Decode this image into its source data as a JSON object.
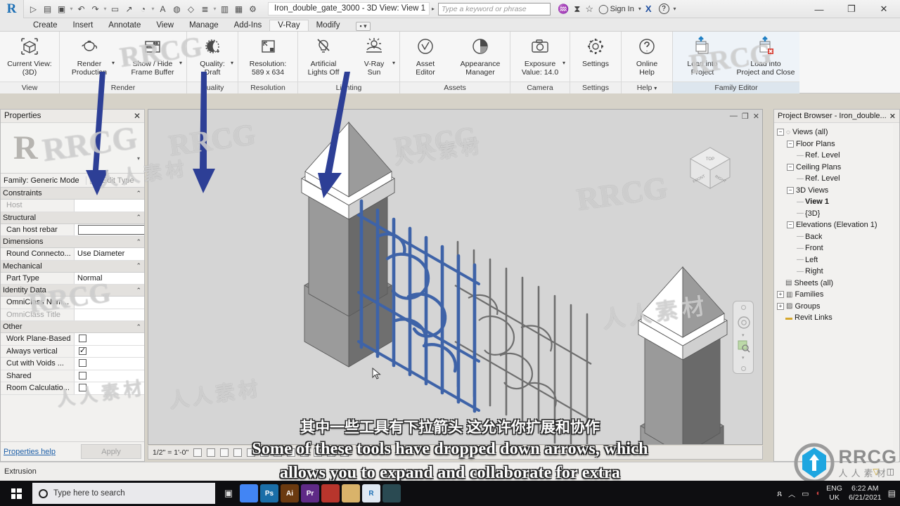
{
  "titlebar": {
    "app_logo": "revit-r-logo",
    "document_title": "Iron_double_gate_3000 - 3D View: View 1",
    "search_placeholder": "Type a keyword or phrase",
    "signin_label": "Sign In",
    "quick_access": [
      {
        "name": "open-icon",
        "glyph": "▷"
      },
      {
        "name": "save-icon",
        "glyph": "▤"
      },
      {
        "name": "save-as-icon",
        "glyph": "▣"
      },
      {
        "name": "undo-icon",
        "glyph": "↶"
      },
      {
        "name": "redo-icon",
        "glyph": "↷"
      },
      {
        "name": "measure-icon",
        "glyph": "▭"
      },
      {
        "name": "aligned-dimension-icon",
        "glyph": "↗"
      },
      {
        "name": "tag-icon",
        "glyph": "◔"
      },
      {
        "name": "text-icon",
        "glyph": "A"
      },
      {
        "name": "default-3d-view-icon",
        "glyph": "◍"
      },
      {
        "name": "section-icon",
        "glyph": "◇"
      },
      {
        "name": "thin-lines-icon",
        "glyph": "≣"
      },
      {
        "name": "close-hidden-icon",
        "glyph": "▥"
      },
      {
        "name": "switch-windows-icon",
        "glyph": "▦"
      },
      {
        "name": "customize-qat-icon",
        "glyph": "⚙"
      }
    ],
    "title_icons": [
      {
        "name": "search-binoculars-icon",
        "glyph": "♒"
      },
      {
        "name": "autodesk-community-icon",
        "glyph": "⧗"
      },
      {
        "name": "favorites-star-icon",
        "glyph": "☆"
      },
      {
        "name": "user-account-icon",
        "glyph": "◯"
      }
    ],
    "exchange_label": "X",
    "help_label": "?",
    "window_buttons": {
      "minimize": "—",
      "maximize": "❐",
      "close": "✕"
    }
  },
  "tabs": [
    {
      "label": "Create",
      "active": false
    },
    {
      "label": "Insert",
      "active": false
    },
    {
      "label": "Annotate",
      "active": false
    },
    {
      "label": "View",
      "active": false
    },
    {
      "label": "Manage",
      "active": false
    },
    {
      "label": "Add-Ins",
      "active": false
    },
    {
      "label": "V-Ray",
      "active": true
    },
    {
      "label": "Modify",
      "active": false
    }
  ],
  "tab_extra": "▪ ▾",
  "ribbon": {
    "groups": [
      {
        "name": "View",
        "buttons": [
          {
            "label": "Current View:\n(3D)",
            "icon": "current-view-cube-icon",
            "dropdown": false,
            "width": "wide"
          }
        ]
      },
      {
        "name": "Render",
        "buttons": [
          {
            "label": "Render\nProduction",
            "icon": "teapot-render-icon",
            "dropdown": true,
            "width": "wide"
          },
          {
            "label": "Show / Hide\nFrame Buffer",
            "icon": "frame-buffer-icon",
            "dropdown": true,
            "width": "xwide"
          }
        ]
      },
      {
        "name": "Quality",
        "buttons": [
          {
            "label": "Quality:\nDraft",
            "icon": "quality-moon-icon",
            "dropdown": true,
            "width": ""
          }
        ]
      },
      {
        "name": "Resolution",
        "buttons": [
          {
            "label": "Resolution:\n589 x 634",
            "icon": "resolution-frame-icon",
            "dropdown": false,
            "width": "wide"
          }
        ]
      },
      {
        "name": "Lighting",
        "buttons": [
          {
            "label": "Artificial\nLights Off",
            "icon": "light-bulb-off-icon",
            "dropdown": false,
            "width": ""
          },
          {
            "label": "V-Ray\nSun",
            "icon": "sun-icon",
            "dropdown": true,
            "width": ""
          }
        ]
      },
      {
        "name": "Assets",
        "buttons": [
          {
            "label": "Asset\nEditor",
            "icon": "asset-editor-icon",
            "dropdown": false,
            "width": ""
          },
          {
            "label": "Appearance\nManager",
            "icon": "appearance-manager-icon",
            "dropdown": false,
            "width": "wide"
          }
        ]
      },
      {
        "name": "Camera",
        "buttons": [
          {
            "label": "Exposure\nValue: 14.0",
            "icon": "camera-icon",
            "dropdown": true,
            "width": "wide"
          }
        ]
      },
      {
        "name": "Settings",
        "buttons": [
          {
            "label": "Settings",
            "icon": "gear-icon",
            "dropdown": false,
            "width": ""
          }
        ]
      },
      {
        "name": "Help",
        "name_dropdown": true,
        "buttons": [
          {
            "label": "Online\nHelp",
            "icon": "question-circle-icon",
            "dropdown": false,
            "width": ""
          }
        ]
      },
      {
        "name": "Family Editor",
        "highlight": true,
        "buttons": [
          {
            "label": "Load into\nProject",
            "icon": "load-into-project-icon",
            "dropdown": false,
            "width": "wide"
          },
          {
            "label": "Load into\nProject and Close",
            "icon": "load-into-project-close-icon",
            "dropdown": false,
            "width": "xwide"
          }
        ]
      }
    ]
  },
  "properties": {
    "title": "Properties",
    "close_glyph": "✕",
    "family_label": "Family: Generic Mode",
    "edit_type_label": "Edit Type",
    "rows": [
      {
        "kind": "section",
        "label": "Constraints"
      },
      {
        "kind": "row",
        "key": "Host",
        "value": "",
        "key_dim": true,
        "value_type": "text"
      },
      {
        "kind": "section",
        "label": "Structural"
      },
      {
        "kind": "row",
        "key": "Can host rebar",
        "value": "",
        "value_type": "checkbox-big",
        "checked": false
      },
      {
        "kind": "section",
        "label": "Dimensions"
      },
      {
        "kind": "row",
        "key": "Round Connecto...",
        "value": "Use Diameter",
        "value_type": "text"
      },
      {
        "kind": "section",
        "label": "Mechanical"
      },
      {
        "kind": "row",
        "key": "Part Type",
        "value": "Normal",
        "value_type": "text"
      },
      {
        "kind": "section",
        "label": "Identity Data"
      },
      {
        "kind": "row",
        "key": "OmniClass Num...",
        "value": "",
        "value_type": "text"
      },
      {
        "kind": "row",
        "key": "OmniClass Title",
        "value": "",
        "key_dim": true,
        "value_type": "text"
      },
      {
        "kind": "section",
        "label": "Other"
      },
      {
        "kind": "row",
        "key": "Work Plane-Based",
        "value": "",
        "value_type": "checkbox",
        "checked": false
      },
      {
        "kind": "row",
        "key": "Always vertical",
        "value": "",
        "value_type": "checkbox",
        "checked": true
      },
      {
        "kind": "row",
        "key": "Cut with Voids ...",
        "value": "",
        "value_type": "checkbox",
        "checked": false
      },
      {
        "kind": "row",
        "key": "Shared",
        "value": "",
        "value_type": "checkbox",
        "checked": false
      },
      {
        "kind": "row",
        "key": "Room Calculatio...",
        "value": "",
        "value_type": "checkbox",
        "checked": false
      }
    ],
    "help_link": "Properties help",
    "apply_label": "Apply"
  },
  "project_browser": {
    "title": "Project Browser - Iron_double...",
    "close_glyph": "✕",
    "tree": [
      {
        "label": "Views (all)",
        "depth": 0,
        "expander": "−",
        "icon": "views-icon",
        "bold": false
      },
      {
        "label": "Floor Plans",
        "depth": 1,
        "expander": "−",
        "icon": "",
        "bold": false
      },
      {
        "label": "Ref. Level",
        "depth": 2,
        "expander": "",
        "icon": "",
        "bold": false
      },
      {
        "label": "Ceiling Plans",
        "depth": 1,
        "expander": "−",
        "icon": "",
        "bold": false
      },
      {
        "label": "Ref. Level",
        "depth": 2,
        "expander": "",
        "icon": "",
        "bold": false
      },
      {
        "label": "3D Views",
        "depth": 1,
        "expander": "−",
        "icon": "",
        "bold": false
      },
      {
        "label": "View 1",
        "depth": 2,
        "expander": "",
        "icon": "",
        "bold": true
      },
      {
        "label": "{3D}",
        "depth": 2,
        "expander": "",
        "icon": "",
        "bold": false
      },
      {
        "label": "Elevations (Elevation 1)",
        "depth": 1,
        "expander": "−",
        "icon": "",
        "bold": false
      },
      {
        "label": "Back",
        "depth": 2,
        "expander": "",
        "icon": "",
        "bold": false
      },
      {
        "label": "Front",
        "depth": 2,
        "expander": "",
        "icon": "",
        "bold": false
      },
      {
        "label": "Left",
        "depth": 2,
        "expander": "",
        "icon": "",
        "bold": false
      },
      {
        "label": "Right",
        "depth": 2,
        "expander": "",
        "icon": "",
        "bold": false
      },
      {
        "label": "Sheets (all)",
        "depth": 0,
        "expander": "",
        "icon": "sheets-icon",
        "bold": false
      },
      {
        "label": "Families",
        "depth": 0,
        "expander": "+",
        "icon": "families-icon",
        "bold": false
      },
      {
        "label": "Groups",
        "depth": 0,
        "expander": "+",
        "icon": "groups-icon",
        "bold": false
      },
      {
        "label": "Revit Links",
        "depth": 0,
        "expander": "",
        "icon": "revit-links-icon",
        "bold": false
      }
    ]
  },
  "viewport": {
    "minimize_glyph": "—",
    "restore_glyph": "❐",
    "close_glyph": "✕",
    "navcube_faces": {
      "top": "TOP",
      "front": "FRONT",
      "right": "RIGHT"
    },
    "model_colors": {
      "gate_selected": "#3e63a8",
      "gate_unselected": "#7c7c7c",
      "pillar_dark": "#6e6e6e",
      "pillar_light": "#b5b5b5",
      "background": "#d5d5d5"
    }
  },
  "view_control_bar": {
    "scale": "1/2\" = 1'-0\"",
    "detail_level": "detail-level-icon",
    "visual_style": "visual-style-icon",
    "sun_path": "sun-path-icon",
    "shadows": "shadows-icon",
    "crop_view": "crop-view-icon",
    "hide_crop": "hide-crop-icon",
    "lock_view": "lock-3d-view-icon",
    "temp_hide": "temp-hide-isolate-icon",
    "reveal_hidden": "reveal-hidden-icon",
    "analytical_model": "analytical-model-icon",
    "constraints": "constraints-icon"
  },
  "statusbar": {
    "message": "Extrusion",
    "right_icons": [
      {
        "name": "filter-icon",
        "glyph": "▽"
      },
      {
        "name": "selection-count-icon",
        "glyph": "◫"
      }
    ]
  },
  "annotations": {
    "arrow_color": "#2d3f96",
    "arrows": [
      {
        "name": "arrow-to-render-production",
        "points_at": "Render Production"
      },
      {
        "name": "arrow-to-quality-draft",
        "points_at": "Quality: Draft"
      },
      {
        "name": "arrow-to-vray-sun",
        "points_at": "V-Ray Sun"
      }
    ]
  },
  "subtitles": {
    "chinese": "其中一些工具有下拉箭头 这允许你扩展和协作",
    "english_line1": "Some of these tools have dropped down arrows, which",
    "english_line2": "allows you to expand and collaborate for extra"
  },
  "watermark": {
    "brand": "RRCG",
    "brand_cn": "人人素材",
    "tiles": [
      "RRCG",
      "人人素材"
    ]
  },
  "taskbar": {
    "search_placeholder": "Type here to search",
    "apps": [
      {
        "name": "task-view-icon",
        "label": "▣",
        "color": "#0e0e11"
      },
      {
        "name": "chrome-icon",
        "label": "",
        "color": "#4285f4"
      },
      {
        "name": "photoshop-icon",
        "label": "Ps",
        "color": "#1a6ea8"
      },
      {
        "name": "illustrator-icon",
        "label": "Ai",
        "color": "#6b3a10"
      },
      {
        "name": "premiere-icon",
        "label": "Pr",
        "color": "#5f2a86"
      },
      {
        "name": "app-red-icon",
        "label": "",
        "color": "#b8352c"
      },
      {
        "name": "explorer-icon",
        "label": "",
        "color": "#d9b36a"
      },
      {
        "name": "revit-icon",
        "label": "R",
        "color": "#dfe8f2"
      },
      {
        "name": "app-teal-icon",
        "label": "",
        "color": "#2a4a52"
      }
    ],
    "tray": [
      {
        "name": "people-icon",
        "glyph": "ጸ"
      },
      {
        "name": "show-hidden-icons-chevron",
        "glyph": "︿"
      },
      {
        "name": "network-icon",
        "glyph": "▭"
      },
      {
        "name": "volume-icon",
        "glyph": "◖"
      }
    ],
    "language_line1": "ENG",
    "language_line2": "UK",
    "time": "6:22 AM",
    "date": "6/21/2021",
    "notification_icon": "notification-icon"
  }
}
